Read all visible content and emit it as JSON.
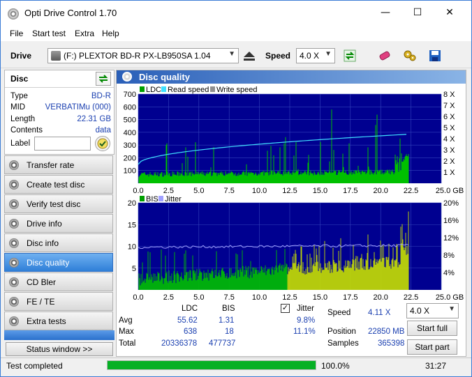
{
  "window": {
    "title": "Opti Drive Control 1.70",
    "minimize": "—",
    "maximize": "☐",
    "close": "✕"
  },
  "menu": [
    "File",
    "Start test",
    "Extra",
    "Help"
  ],
  "toolbar": {
    "drive_label": "Drive",
    "drive_value": "(F:)   PLEXTOR BD-R  PX-LB950SA 1.04",
    "speed_label": "Speed",
    "speed_value": "4.0 X"
  },
  "disc": {
    "header": "Disc",
    "rows": [
      {
        "label": "Type",
        "value": "BD-R"
      },
      {
        "label": "MID",
        "value": "VERBATIMu (000)"
      },
      {
        "label": "Length",
        "value": "22.31 GB"
      },
      {
        "label": "Contents",
        "value": "data"
      }
    ],
    "label_label": "Label",
    "label_value": ""
  },
  "nav": [
    {
      "label": "Transfer rate",
      "active": false
    },
    {
      "label": "Create test disc",
      "active": false
    },
    {
      "label": "Verify test disc",
      "active": false
    },
    {
      "label": "Drive info",
      "active": false
    },
    {
      "label": "Disc info",
      "active": false
    },
    {
      "label": "Disc quality",
      "active": true
    },
    {
      "label": "CD Bler",
      "active": false
    },
    {
      "label": "FE / TE",
      "active": false
    },
    {
      "label": "Extra tests",
      "active": false
    }
  ],
  "status_window_button": "Status window >>",
  "panel_title": "Disc quality",
  "chart_data": [
    {
      "type": "bar",
      "legend": [
        "LDC",
        "Read speed",
        "Write speed"
      ],
      "x_ticks": [
        "0.0",
        "2.5",
        "5.0",
        "7.5",
        "10.0",
        "12.5",
        "15.0",
        "17.5",
        "20.0",
        "22.5",
        "25.0 GB"
      ],
      "y_ticks": [
        "700",
        "600",
        "500",
        "400",
        "300",
        "200",
        "100"
      ],
      "y2_ticks": [
        "8 X",
        "7 X",
        "6 X",
        "5 X",
        "4 X",
        "3 X",
        "2 X",
        "1 X"
      ],
      "xlim": [
        0,
        25
      ],
      "ylim": [
        0,
        700
      ],
      "y2lim": [
        0,
        8
      ],
      "data_end_gb": 22.31,
      "read_speed_start_x": 1.7,
      "read_speed_end_x": 4.4,
      "ldc_baseline": 50,
      "colors": {
        "ldc": "#00c000",
        "read": "#40e0ff",
        "bg": "#000090",
        "grid": "#3344bb"
      }
    },
    {
      "type": "bar",
      "legend": [
        "BIS",
        "Jitter"
      ],
      "x_ticks": [
        "0.0",
        "2.5",
        "5.0",
        "7.5",
        "10.0",
        "12.5",
        "15.0",
        "17.5",
        "20.0",
        "22.5",
        "25.0 GB"
      ],
      "y_ticks": [
        "20",
        "15",
        "10",
        "5"
      ],
      "y2_ticks": [
        "20%",
        "16%",
        "12%",
        "8%",
        "4%"
      ],
      "xlim": [
        0,
        25
      ],
      "ylim": [
        0,
        20
      ],
      "y2lim": [
        0,
        20
      ],
      "data_end_gb": 22.31,
      "jitter_avg": 9.8,
      "colors": {
        "bis": "#00c000",
        "bis_hi": "#c8e000",
        "jitter": "#a0a0ff",
        "bg": "#000090",
        "grid": "#3344bb"
      }
    }
  ],
  "stats": {
    "col_ldc": "LDC",
    "col_bis": "BIS",
    "col_jitter": "Jitter",
    "jitter_checked": "✓",
    "avg_label": "Avg",
    "avg_ldc": "55.62",
    "avg_bis": "1.31",
    "avg_jitter": "9.8%",
    "max_label": "Max",
    "max_ldc": "638",
    "max_bis": "18",
    "max_jitter": "11.1%",
    "total_label": "Total",
    "total_ldc": "20336378",
    "total_bis": "477737",
    "speed_label": "Speed",
    "speed_value": "4.11 X",
    "position_label": "Position",
    "position_value": "22850 MB",
    "samples_label": "Samples",
    "samples_value": "365398",
    "speed_select": "4.0 X",
    "start_full": "Start full",
    "start_part": "Start part"
  },
  "statusbar": {
    "text": "Test completed",
    "progress_pct": "100.0%",
    "progress": 1.0,
    "time": "31:27"
  }
}
